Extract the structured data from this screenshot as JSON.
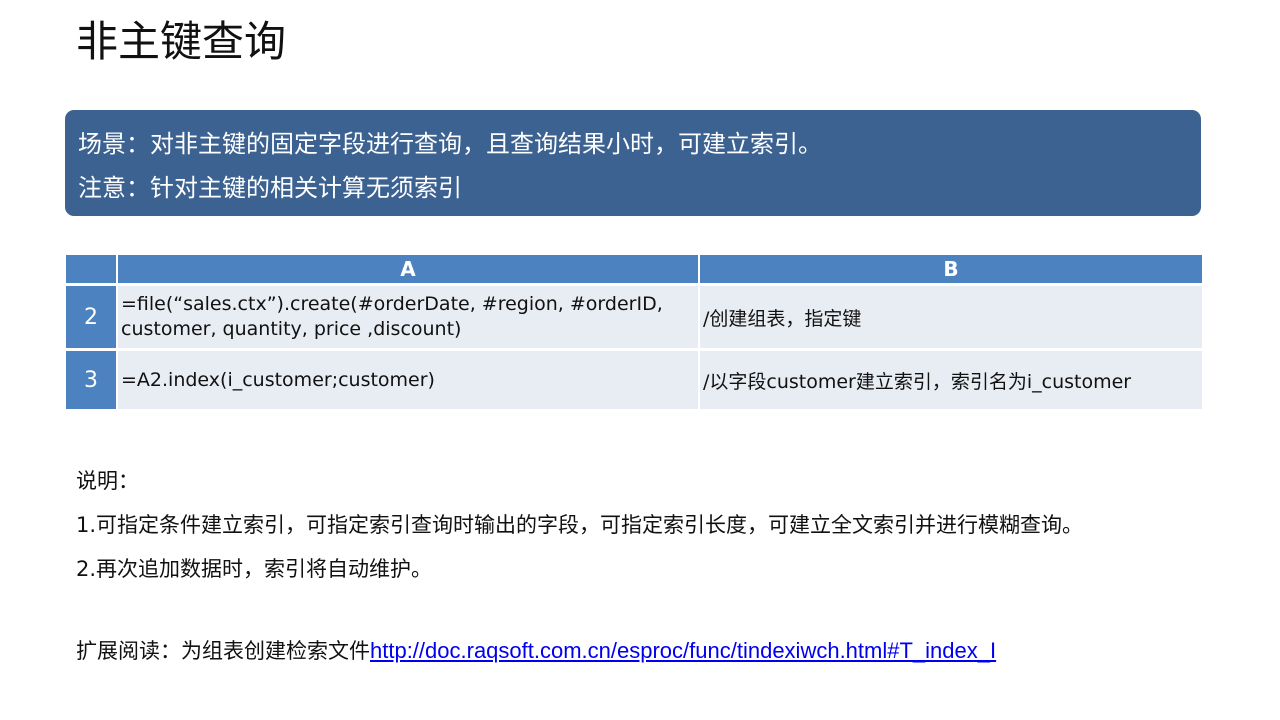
{
  "title": "非主键查询",
  "callout": {
    "lines": [
      "场景：对非主键的固定字段进行查询，且查询结果小时，可建立索引。",
      "注意：针对主键的相关计算无须索引"
    ]
  },
  "grid": {
    "columns": [
      "",
      "A",
      "B"
    ],
    "rows": [
      {
        "num": "2",
        "a_line1": "=file(“sales.ctx”).create(#orderDate, #region, #orderID,",
        "a_line2": "customer, quantity, price ,discount)",
        "b": "/创建组表，指定键"
      },
      {
        "num": "3",
        "a_line1": "=A2.index(i_customer;customer)",
        "a_line2": "",
        "b": "/以字段customer建立索引，索引名为i_customer"
      }
    ]
  },
  "notes": [
    "说明：",
    "1.可指定条件建立索引，可指定索引查询时输出的字段，可指定索引长度，可建立全文索引并进行模糊查询。",
    "2.再次追加数据时，索引将自动维护。"
  ],
  "further": {
    "label": "扩展阅读：为组表创建检索文件",
    "link": "http://doc.raqsoft.com.cn/esproc/func/tindexiwch.html#T_index_I"
  },
  "colors": {
    "callout_bg": "#3c6292",
    "header_bg": "#4c82bf",
    "cell_bg": "#e8ecf3"
  }
}
